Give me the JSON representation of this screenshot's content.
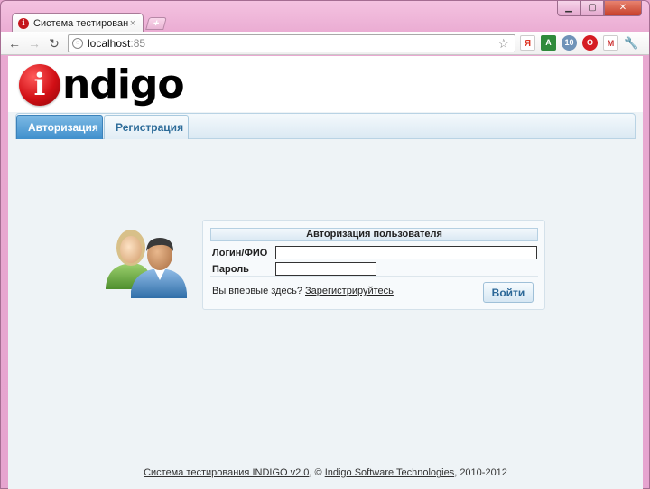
{
  "browser": {
    "tab_title": "Система тестирования",
    "tab_close": "×",
    "new_tab": "+",
    "url_host": "localhost",
    "url_port": ":85"
  },
  "logo": {
    "mark": "i",
    "text": "ndigo"
  },
  "tabs": [
    {
      "label": "Авторизация",
      "active": true
    },
    {
      "label": "Регистрация",
      "active": false
    }
  ],
  "login": {
    "title": "Авторизация пользователя",
    "login_label": "Логин/ФИО",
    "login_value": "",
    "password_label": "Пароль",
    "password_value": "",
    "first_time_text": "Вы впервые здесь?",
    "register_link": "Зарегистрируйтесь",
    "submit_label": "Войти"
  },
  "footer": {
    "system_link": "Система тестирования INDIGO v2.0",
    "separator": ", © ",
    "company_link": "Indigo Software Technologies",
    "years": ", 2010-2012"
  },
  "colors": {
    "accent": "#3f8fcc",
    "brand_red": "#d10f15",
    "chrome_pink": "#e9a9d1"
  }
}
